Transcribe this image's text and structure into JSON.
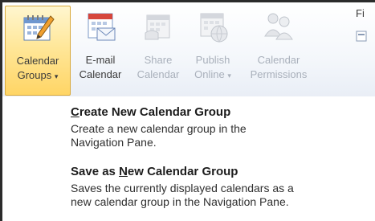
{
  "ribbon": {
    "buttons": [
      {
        "id": "calendar-groups",
        "line1": "Calendar",
        "line2": "Groups",
        "dropdown": true,
        "state": "active",
        "icon": "calendar-pencil-icon"
      },
      {
        "id": "email-calendar",
        "line1": "E-mail",
        "line2": "Calendar",
        "dropdown": false,
        "state": "enabled",
        "icon": "calendar-email-icon"
      },
      {
        "id": "share-calendar",
        "line1": "Share",
        "line2": "Calendar",
        "dropdown": false,
        "state": "disabled",
        "icon": "calendar-share-icon"
      },
      {
        "id": "publish-online",
        "line1": "Publish",
        "line2": "Online",
        "dropdown": true,
        "state": "disabled",
        "icon": "calendar-globe-icon"
      },
      {
        "id": "calendar-permissions",
        "line1": "Calendar",
        "line2": "Permissions",
        "dropdown": false,
        "state": "disabled",
        "icon": "calendar-permissions-icon"
      }
    ],
    "clipped_label": "Fi"
  },
  "menu": {
    "items": [
      {
        "title_pre": "",
        "title_key": "C",
        "title_post": "reate New Calendar Group",
        "description": "Create a new calendar group in the Navigation Pane.",
        "desc_line1": "Create a new calendar group in the",
        "desc_line2": "Navigation Pane."
      },
      {
        "title_pre": "Save as ",
        "title_key": "N",
        "title_post": "ew Calendar Group",
        "desc_line1": "Saves the currently displayed calendars as a",
        "desc_line2": "new calendar group in the Navigation Pane."
      }
    ]
  },
  "colors": {
    "active_button_top": "#fff6cf",
    "active_button_bottom": "#ffd565",
    "disabled_text": "#a9b0bb",
    "frame": "#2b2b2b"
  }
}
